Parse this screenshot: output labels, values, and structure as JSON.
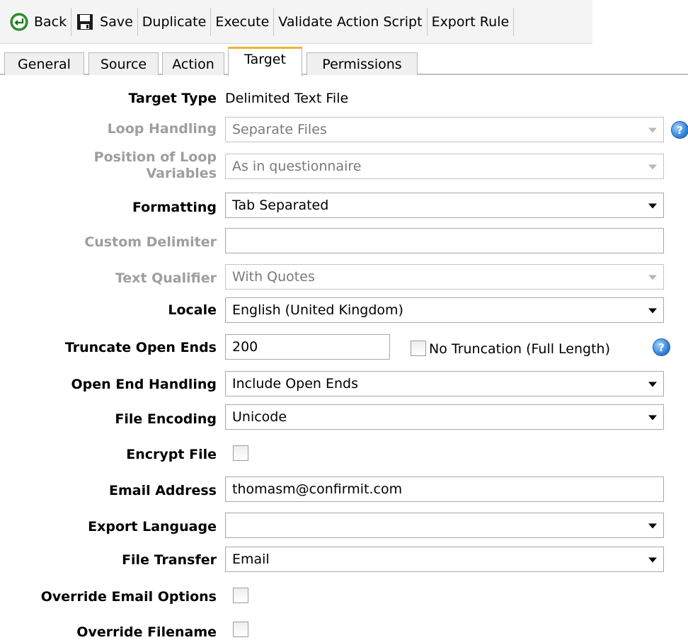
{
  "toolbar": {
    "back": "Back",
    "save": "Save",
    "duplicate": "Duplicate",
    "execute": "Execute",
    "validate": "Validate Action Script",
    "export_rule": "Export Rule"
  },
  "tabs": [
    "General",
    "Source",
    "Action",
    "Target",
    "Permissions"
  ],
  "active_tab": "Target",
  "form": {
    "target_type": {
      "label": "Target Type",
      "value": "Delimited Text File"
    },
    "loop_handling": {
      "label": "Loop Handling",
      "value": "Separate Files"
    },
    "position_loop": {
      "label": "Position of Loop Variables",
      "value": "As in questionnaire"
    },
    "formatting": {
      "label": "Formatting",
      "value": "Tab Separated"
    },
    "custom_delimiter": {
      "label": "Custom Delimiter",
      "value": ""
    },
    "text_qualifier": {
      "label": "Text Qualifier",
      "value": "With Quotes"
    },
    "locale": {
      "label": "Locale",
      "value": "English (United Kingdom)"
    },
    "truncate": {
      "label": "Truncate Open Ends",
      "value": "200",
      "checkbox_label": "No Truncation (Full Length)"
    },
    "open_end_handling": {
      "label": "Open End Handling",
      "value": "Include Open Ends"
    },
    "file_encoding": {
      "label": "File Encoding",
      "value": "Unicode"
    },
    "encrypt_file": {
      "label": "Encrypt File"
    },
    "email_address": {
      "label": "Email Address",
      "value": "thomasm@confirmit.com"
    },
    "export_language": {
      "label": "Export Language",
      "value": ""
    },
    "file_transfer": {
      "label": "File Transfer",
      "value": "Email"
    },
    "override_email": {
      "label": "Override Email Options"
    },
    "override_filename": {
      "label": "Override Filename"
    }
  },
  "colors": {
    "active_tab_accent": "#f2b233",
    "help_icon": "#2f7fd6"
  },
  "icons": {
    "back": "back-arrow-icon",
    "save": "floppy-disk-icon",
    "help": "help-icon"
  }
}
